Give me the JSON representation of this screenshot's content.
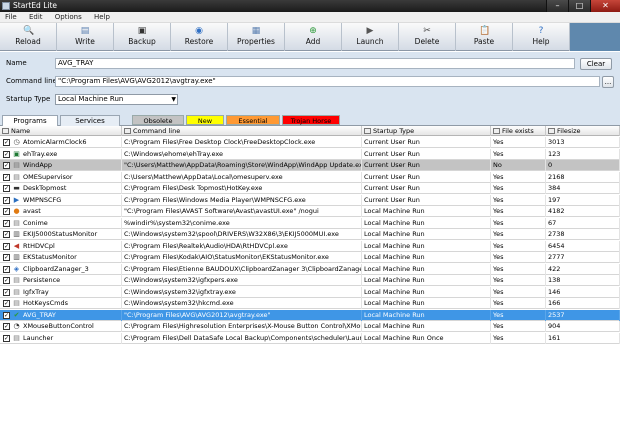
{
  "window": {
    "title": "StartEd Lite",
    "controls": {
      "minimize": "–",
      "maximize": "□",
      "close": "✕"
    }
  },
  "menu": [
    "File",
    "Edit",
    "Options",
    "Help"
  ],
  "toolbar": {
    "buttons": [
      {
        "label": "Reload",
        "icon": "reload-icon",
        "glyph": "🔍",
        "color": "#c98a2b"
      },
      {
        "label": "Write",
        "icon": "write-icon",
        "glyph": "▤",
        "color": "#5a7fb0"
      },
      {
        "label": "Backup",
        "icon": "backup-icon",
        "glyph": "▣",
        "color": "#333333"
      },
      {
        "label": "Restore",
        "icon": "restore-icon",
        "glyph": "◉",
        "color": "#2f6fc4"
      },
      {
        "label": "Properties",
        "icon": "properties-icon",
        "glyph": "▦",
        "color": "#5a7fb0"
      },
      {
        "label": "Add",
        "icon": "add-icon",
        "glyph": "⊕",
        "color": "#2d9a3a"
      },
      {
        "label": "Launch",
        "icon": "launch-icon",
        "glyph": "▶",
        "color": "#555555"
      },
      {
        "label": "Delete",
        "icon": "delete-icon",
        "glyph": "✂",
        "color": "#444444"
      },
      {
        "label": "Paste",
        "icon": "paste-icon",
        "glyph": "📋",
        "color": "#b5892e"
      },
      {
        "label": "Help",
        "icon": "help-icon",
        "glyph": "?",
        "color": "#2f6fc4"
      }
    ]
  },
  "form": {
    "name_label": "Name",
    "name_value": "AVG_TRAY",
    "clear_label": "Clear",
    "cmd_label": "Command line",
    "cmd_value": "\"C:\\Program Files\\AVG\\AVG2012\\avgtray.exe\"",
    "browse_label": "...",
    "startup_label": "Startup Type",
    "startup_value": "Local Machine Run"
  },
  "tabs": [
    {
      "label": "Programs",
      "active": true
    },
    {
      "label": "Services",
      "active": false
    }
  ],
  "legend": [
    {
      "label": "Obsolete",
      "color": "#c3c3c3"
    },
    {
      "label": "New",
      "color": "#ffff00"
    },
    {
      "label": "Essential",
      "color": "#ff9933"
    },
    {
      "label": "Trojan Horse",
      "color": "#ff0000"
    }
  ],
  "columns": {
    "name": "Name",
    "cmd": "Command line",
    "type": "Startup Type",
    "exists": "File exists",
    "size": "Filesize"
  },
  "rows": [
    {
      "name": "AtomicAlarmClock6",
      "cmd": "C:\\Program Files\\Free Desktop Clock\\FreeDesktopClock.exe",
      "type": "Current User Run",
      "exists": "Yes",
      "size": "3013",
      "icon": "clock-icon",
      "glyph": "◷",
      "icolor": "#4a4a4a",
      "checked": true
    },
    {
      "name": "ehTray.exe",
      "cmd": "C:\\Windows\\ehome\\ehTray.exe",
      "type": "Current User Run",
      "exists": "Yes",
      "size": "123",
      "icon": "media-center-icon",
      "glyph": "▣",
      "icolor": "#1f7a34",
      "checked": true
    },
    {
      "name": "WindApp",
      "cmd": "\"C:\\Users\\Matthew\\AppData\\Roaming\\Store\\WindApp\\WindApp Update.exe\" /win",
      "type": "Current User Run",
      "exists": "No",
      "size": "0",
      "icon": "app-icon",
      "glyph": "▤",
      "icolor": "#777777",
      "checked": true
    },
    {
      "name": "OMESupervisor",
      "cmd": "C:\\Users\\Matthew\\AppData\\Local\\omesuperv.exe",
      "type": "Current User Run",
      "exists": "Yes",
      "size": "2168",
      "icon": "app-icon",
      "glyph": "▤",
      "icolor": "#777777",
      "checked": true
    },
    {
      "name": "DeskTopmost",
      "cmd": "C:\\Program Files\\Desk Topmost\\HotKey.exe",
      "type": "Current User Run",
      "exists": "Yes",
      "size": "384",
      "icon": "desktop-icon",
      "glyph": "▬",
      "icolor": "#333333",
      "checked": true
    },
    {
      "name": "WMPNSCFG",
      "cmd": "C:\\Program Files\\Windows Media Player\\WMPNSCFG.exe",
      "type": "Current User Run",
      "exists": "Yes",
      "size": "197",
      "icon": "media-player-icon",
      "glyph": "▶",
      "icolor": "#2c6fbf",
      "checked": true
    },
    {
      "name": "avast",
      "cmd": "\"C:\\Program Files\\AVAST Software\\Avast\\avastUI.exe\" /nogui",
      "type": "Local Machine Run",
      "exists": "Yes",
      "size": "4182",
      "icon": "avast-icon",
      "glyph": "●",
      "icolor": "#e07a12",
      "checked": true
    },
    {
      "name": "Conime",
      "cmd": "%windir%\\system32\\conime.exe",
      "type": "Local Machine Run",
      "exists": "Yes",
      "size": "67",
      "icon": "app-icon",
      "glyph": "▤",
      "icolor": "#777777",
      "checked": true
    },
    {
      "name": "EKIJ5000StatusMonitor",
      "cmd": "C:\\Windows\\system32\\spool\\DRIVERS\\W32X86\\3\\EKIJ5000MUI.exe",
      "type": "Local Machine Run",
      "exists": "Yes",
      "size": "2738",
      "icon": "printer-icon",
      "glyph": "▥",
      "icolor": "#444444",
      "checked": true
    },
    {
      "name": "RtHDVCpl",
      "cmd": "C:\\Program Files\\Realtek\\Audio\\HDA\\RtHDVCpl.exe",
      "type": "Local Machine Run",
      "exists": "Yes",
      "size": "6454",
      "icon": "speaker-icon",
      "glyph": "◀",
      "icolor": "#c0392b",
      "checked": true
    },
    {
      "name": "EKStatusMonitor",
      "cmd": "C:\\Program Files\\Kodak\\AIO\\StatusMonitor\\EKStatusMonitor.exe",
      "type": "Local Machine Run",
      "exists": "Yes",
      "size": "2777",
      "icon": "printer-icon",
      "glyph": "▥",
      "icolor": "#444444",
      "checked": true
    },
    {
      "name": "ClipboardZanager_3",
      "cmd": "C:\\Program Files\\Etienne BAUDOUX\\ClipboardZanager 3\\ClipboardZanager 3.exe",
      "type": "Local Machine Run",
      "exists": "Yes",
      "size": "422",
      "icon": "clipboard-icon",
      "glyph": "◈",
      "icolor": "#2f6fc4",
      "checked": true
    },
    {
      "name": "Persistence",
      "cmd": "C:\\Windows\\system32\\igfxpers.exe",
      "type": "Local Machine Run",
      "exists": "Yes",
      "size": "138",
      "icon": "app-icon",
      "glyph": "▤",
      "icolor": "#777777",
      "checked": true
    },
    {
      "name": "IgfxTray",
      "cmd": "C:\\Windows\\system32\\igfxtray.exe",
      "type": "Local Machine Run",
      "exists": "Yes",
      "size": "146",
      "icon": "app-icon",
      "glyph": "▤",
      "icolor": "#777777",
      "checked": true
    },
    {
      "name": "HotKeysCmds",
      "cmd": "C:\\Windows\\system32\\hkcmd.exe",
      "type": "Local Machine Run",
      "exists": "Yes",
      "size": "166",
      "icon": "app-icon",
      "glyph": "▤",
      "icolor": "#777777",
      "checked": true
    },
    {
      "name": "AVG_TRAY",
      "cmd": "\"C:\\Program Files\\AVG\\AVG2012\\avgtray.exe\"",
      "type": "Local Machine Run",
      "exists": "Yes",
      "size": "2537",
      "icon": "avg-icon",
      "glyph": "✔",
      "icolor": "#2d9a3a",
      "checked": true
    },
    {
      "name": "XMouseButtonControl",
      "cmd": "C:\\Program Files\\Highresolution Enterprises\\X-Mouse Button Control\\XMouseButto",
      "type": "Local Machine Run",
      "exists": "Yes",
      "size": "904",
      "icon": "mouse-icon",
      "glyph": "◔",
      "icolor": "#333333",
      "checked": true
    },
    {
      "name": "Launcher",
      "cmd": "C:\\Program Files\\Dell DataSafe Local Backup\\Components\\scheduler\\Launcher.exe",
      "type": "Local Machine Run Once",
      "exists": "Yes",
      "size": "161",
      "icon": "app-icon",
      "glyph": "▤",
      "icolor": "#777777",
      "checked": true
    }
  ],
  "colors": {
    "selected_row": "#3f96e6",
    "obsolete_row": "#c3c3c3",
    "form_background": "#d9e4f0"
  },
  "selected_row_index": 15,
  "obsolete_row_index": 2
}
